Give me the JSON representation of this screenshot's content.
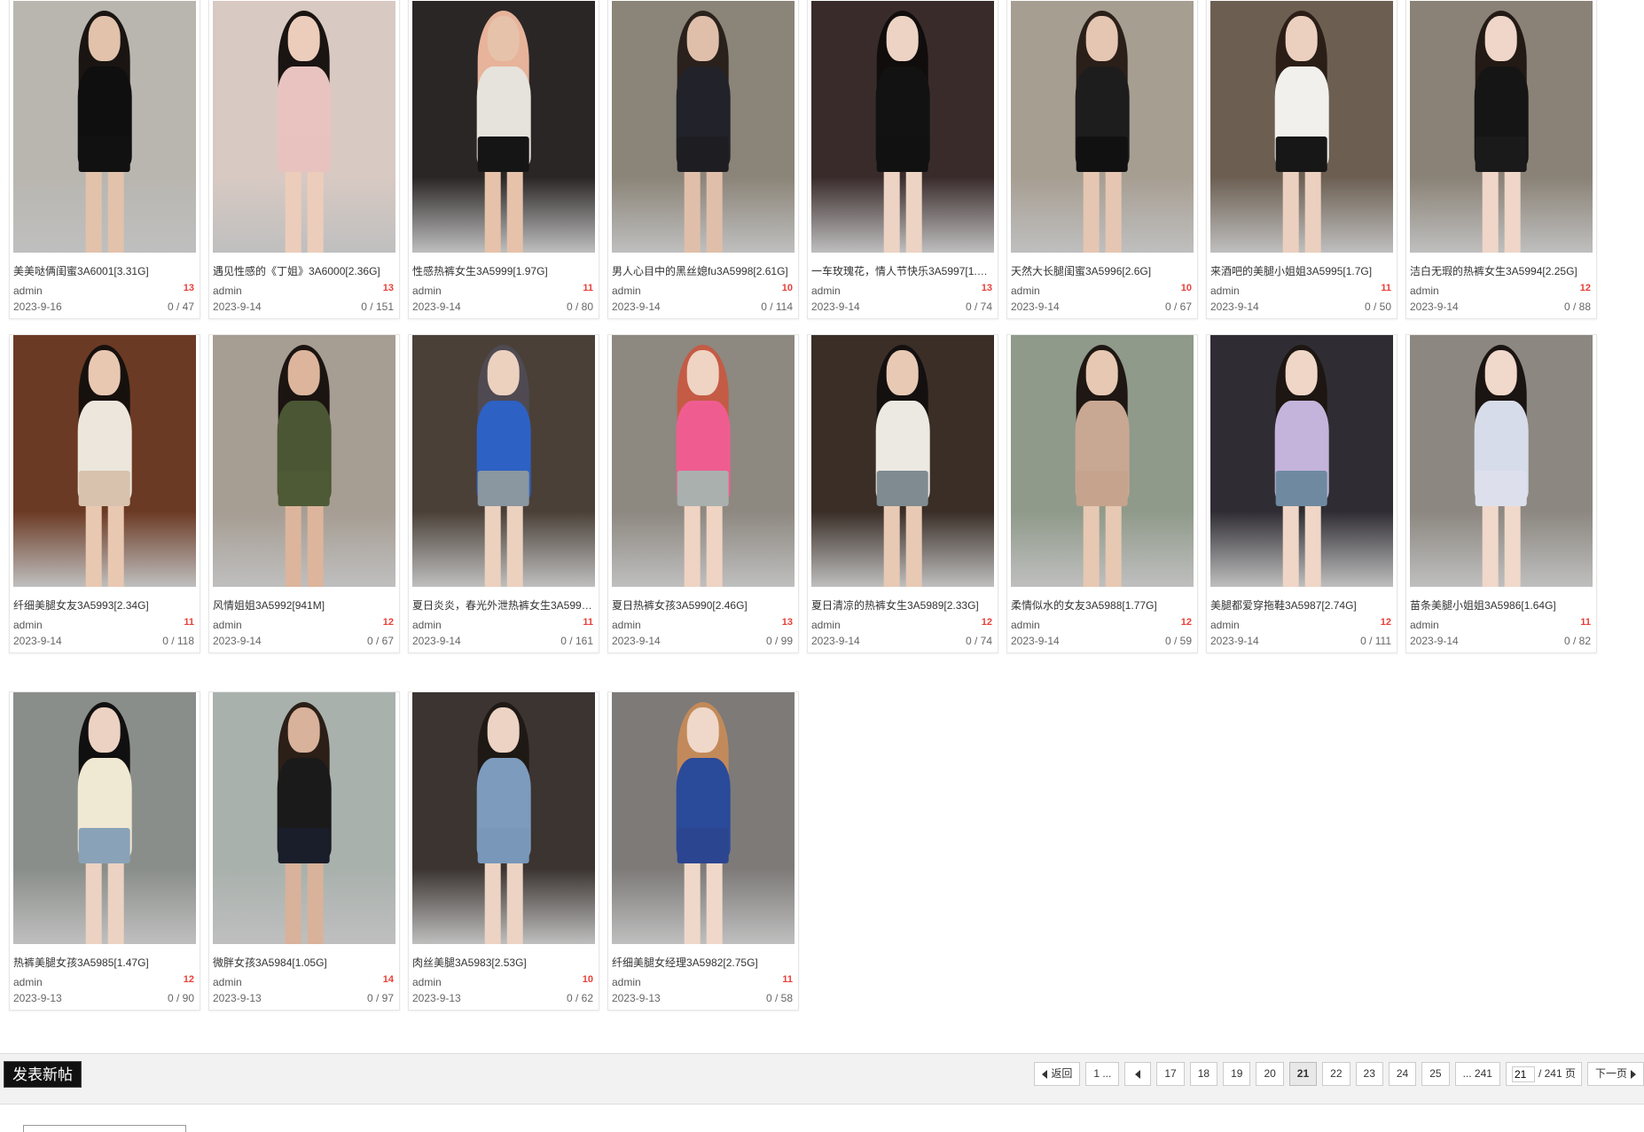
{
  "posts": [
    {
      "title": "美美哒俩闺蜜3A6001[3.31G]",
      "author": "admin",
      "likes": "13",
      "date": "2023-9-16",
      "stats": "0 / 47",
      "thumb": {
        "bg": "#b9b6b0",
        "top": "#0f0f0f",
        "bottom": "#111111",
        "hair": "#1a1512",
        "skin": "#e2c2ab"
      }
    },
    {
      "title": "遇见性感的《丁姐》3A6000[2.36G]",
      "author": "admin",
      "likes": "13",
      "date": "2023-9-14",
      "stats": "0 / 151",
      "thumb": {
        "bg": "#d8c9c2",
        "top": "#e9c3c0",
        "bottom": "#e8c2bf",
        "hair": "#1a1412",
        "skin": "#eccdbb"
      }
    },
    {
      "title": "性感热裤女生3A5999[1.97G]",
      "author": "admin",
      "likes": "11",
      "date": "2023-9-14",
      "stats": "0 / 80",
      "thumb": {
        "bg": "#2b2626",
        "top": "#e6e2dc",
        "bottom": "#151515",
        "hair": "#e7b39a",
        "skin": "#e6c2aa"
      }
    },
    {
      "title": "男人心目中的黑丝媳fu3A5998[2.61G]",
      "author": "admin",
      "likes": "10",
      "date": "2023-9-14",
      "stats": "0 / 114",
      "thumb": {
        "bg": "#8b8478",
        "top": "#22232a",
        "bottom": "#1e1e22",
        "hair": "#2a211c",
        "skin": "#e0bfaa"
      }
    },
    {
      "title": "一车玫瑰花，情人节快乐3A5997[1.…",
      "author": "admin",
      "likes": "13",
      "date": "2023-9-14",
      "stats": "0 / 74",
      "thumb": {
        "bg": "#3a2b2b",
        "top": "#121212",
        "bottom": "#111111",
        "hair": "#100d0c",
        "skin": "#edd3c3"
      }
    },
    {
      "title": "天然大长腿闺蜜3A5996[2.6G]",
      "author": "admin",
      "likes": "10",
      "date": "2023-9-14",
      "stats": "0 / 67",
      "thumb": {
        "bg": "#a79e92",
        "top": "#1d1d1d",
        "bottom": "#111111",
        "hair": "#2b2019",
        "skin": "#e5c6b2"
      }
    },
    {
      "title": "来酒吧的美腿小姐姐3A5995[1.7G]",
      "author": "admin",
      "likes": "11",
      "date": "2023-9-14",
      "stats": "0 / 50",
      "thumb": {
        "bg": "#6c5f52",
        "top": "#f2f0ec",
        "bottom": "#171717",
        "hair": "#2a1e16",
        "skin": "#ecd0bf"
      }
    },
    {
      "title": "洁白无瑕的热裤女生3A5994[2.25G]",
      "author": "admin",
      "likes": "12",
      "date": "2023-9-14",
      "stats": "0 / 88",
      "thumb": {
        "bg": "#8a8276",
        "top": "#151515",
        "bottom": "#1a1a1a",
        "hair": "#231a15",
        "skin": "#efd6c8"
      }
    },
    {
      "title": "纤细美腿女友3A5993[2.34G]",
      "author": "admin",
      "likes": "11",
      "date": "2023-9-14",
      "stats": "0 / 118",
      "thumb": {
        "bg": "#6b3a24",
        "top": "#ece6dd",
        "bottom": "#d8c2ad",
        "hair": "#17110e",
        "skin": "#e9c8b2"
      }
    },
    {
      "title": "风情姐姐3A5992[941M]",
      "author": "admin",
      "likes": "12",
      "date": "2023-9-14",
      "stats": "0 / 67",
      "thumb": {
        "bg": "#a69d93",
        "top": "#4a5634",
        "bottom": "#4e5a36",
        "hair": "#1b1411",
        "skin": "#dcb59c"
      }
    },
    {
      "title": "夏日炎炎，春光外泄热裤女生3A599…",
      "author": "admin",
      "likes": "11",
      "date": "2023-9-14",
      "stats": "0 / 161",
      "thumb": {
        "bg": "#4a4038",
        "top": "#2d61c4",
        "bottom": "#8a96a0",
        "hair": "#4f4a52",
        "skin": "#ecd1bf"
      }
    },
    {
      "title": "夏日热裤女孩3A5990[2.46G]",
      "author": "admin",
      "likes": "13",
      "date": "2023-9-14",
      "stats": "0 / 99",
      "thumb": {
        "bg": "#8d8880",
        "top": "#ef5d90",
        "bottom": "#a9b0ae",
        "hair": "#c45b45",
        "skin": "#efd3c3"
      }
    },
    {
      "title": "夏日清凉的热裤女生3A5989[2.33G]",
      "author": "admin",
      "likes": "12",
      "date": "2023-9-14",
      "stats": "0 / 74",
      "thumb": {
        "bg": "#3a2e27",
        "top": "#ece9e3",
        "bottom": "#7f8b90",
        "hair": "#141010",
        "skin": "#e8c9b4"
      }
    },
    {
      "title": "柔情似水的女友3A5988[1.77G]",
      "author": "admin",
      "likes": "12",
      "date": "2023-9-14",
      "stats": "0 / 59",
      "thumb": {
        "bg": "#8f9a8a",
        "top": "#c9a893",
        "bottom": "#c5a38d",
        "hair": "#1e1713",
        "skin": "#e7c8b2"
      }
    },
    {
      "title": "美腿都爱穿拖鞋3A5987[2.74G]",
      "author": "admin",
      "likes": "12",
      "date": "2023-9-14",
      "stats": "0 / 111",
      "thumb": {
        "bg": "#2f2d33",
        "top": "#c4b4dc",
        "bottom": "#6f8aa0",
        "hair": "#1d1612",
        "skin": "#efd6c6"
      }
    },
    {
      "title": "苗条美腿小姐姐3A5986[1.64G]",
      "author": "admin",
      "likes": "11",
      "date": "2023-9-14",
      "stats": "0 / 82",
      "thumb": {
        "bg": "#8c8780",
        "top": "#d7dcea",
        "bottom": "#dde0ec",
        "hair": "#1a1412",
        "skin": "#f0d8ca"
      }
    },
    {
      "title": "热裤美腿女孩3A5985[1.47G]",
      "author": "admin",
      "likes": "12",
      "date": "2023-9-13",
      "stats": "0 / 90",
      "thumb": {
        "bg": "#8a8e8a",
        "top": "#efe8d2",
        "bottom": "#8aa2b8",
        "hair": "#111010",
        "skin": "#ecd2c2"
      }
    },
    {
      "title": "微胖女孩3A5984[1.05G]",
      "author": "admin",
      "likes": "14",
      "date": "2023-9-13",
      "stats": "0 / 97",
      "thumb": {
        "bg": "#a9b1ad",
        "top": "#1a1a1a",
        "bottom": "#1a1d2a",
        "hair": "#2b1f18",
        "skin": "#d8b29a"
      }
    },
    {
      "title": "肉丝美腿3A5983[2.53G]",
      "author": "admin",
      "likes": "10",
      "date": "2023-9-13",
      "stats": "0 / 62",
      "thumb": {
        "bg": "#3b3431",
        "top": "#7d9bbd",
        "bottom": "#7897b9",
        "hair": "#1f1915",
        "skin": "#ecd3c3"
      }
    },
    {
      "title": "纤细美腿女经理3A5982[2.75G]",
      "author": "admin",
      "likes": "11",
      "date": "2023-9-13",
      "stats": "0 / 58",
      "thumb": {
        "bg": "#7d7a78",
        "top": "#2a4a9a",
        "bottom": "#2b4590",
        "hair": "#c28a5a",
        "skin": "#efd8ca"
      }
    }
  ],
  "new_post_label": "发表新帖",
  "pagination": {
    "back_label": "返回",
    "first_label": "1 ...",
    "pages": [
      "17",
      "18",
      "19",
      "20",
      "21",
      "22",
      "23",
      "24",
      "25"
    ],
    "current": "21",
    "last_label": "... 241",
    "jump_value": "21",
    "total_label": "/ 241 页",
    "next_label": "下一页"
  }
}
